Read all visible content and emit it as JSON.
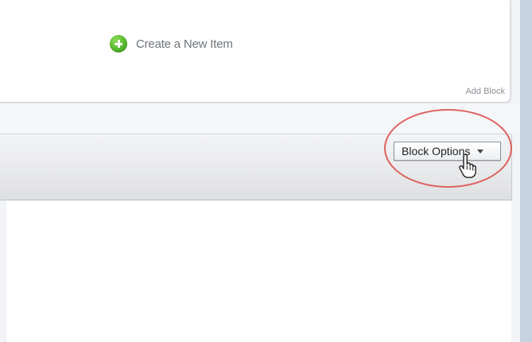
{
  "create_item": {
    "label": "Create a New Item",
    "icon": "plus-circle-icon",
    "icon_color": "#55b82d"
  },
  "top_card": {
    "add_block_label": "Add Block"
  },
  "block_header": {
    "options_button_label": "Block Options",
    "options_icon": "chevron-down-icon"
  },
  "annotation": {
    "shape": "ellipse",
    "color": "#dd625f"
  },
  "cursor": {
    "icon": "hand-pointer-icon"
  },
  "colors": {
    "header_bar": "#e8e9eb",
    "accent_green": "#55b82d",
    "right_border": "#c6d1e2"
  }
}
